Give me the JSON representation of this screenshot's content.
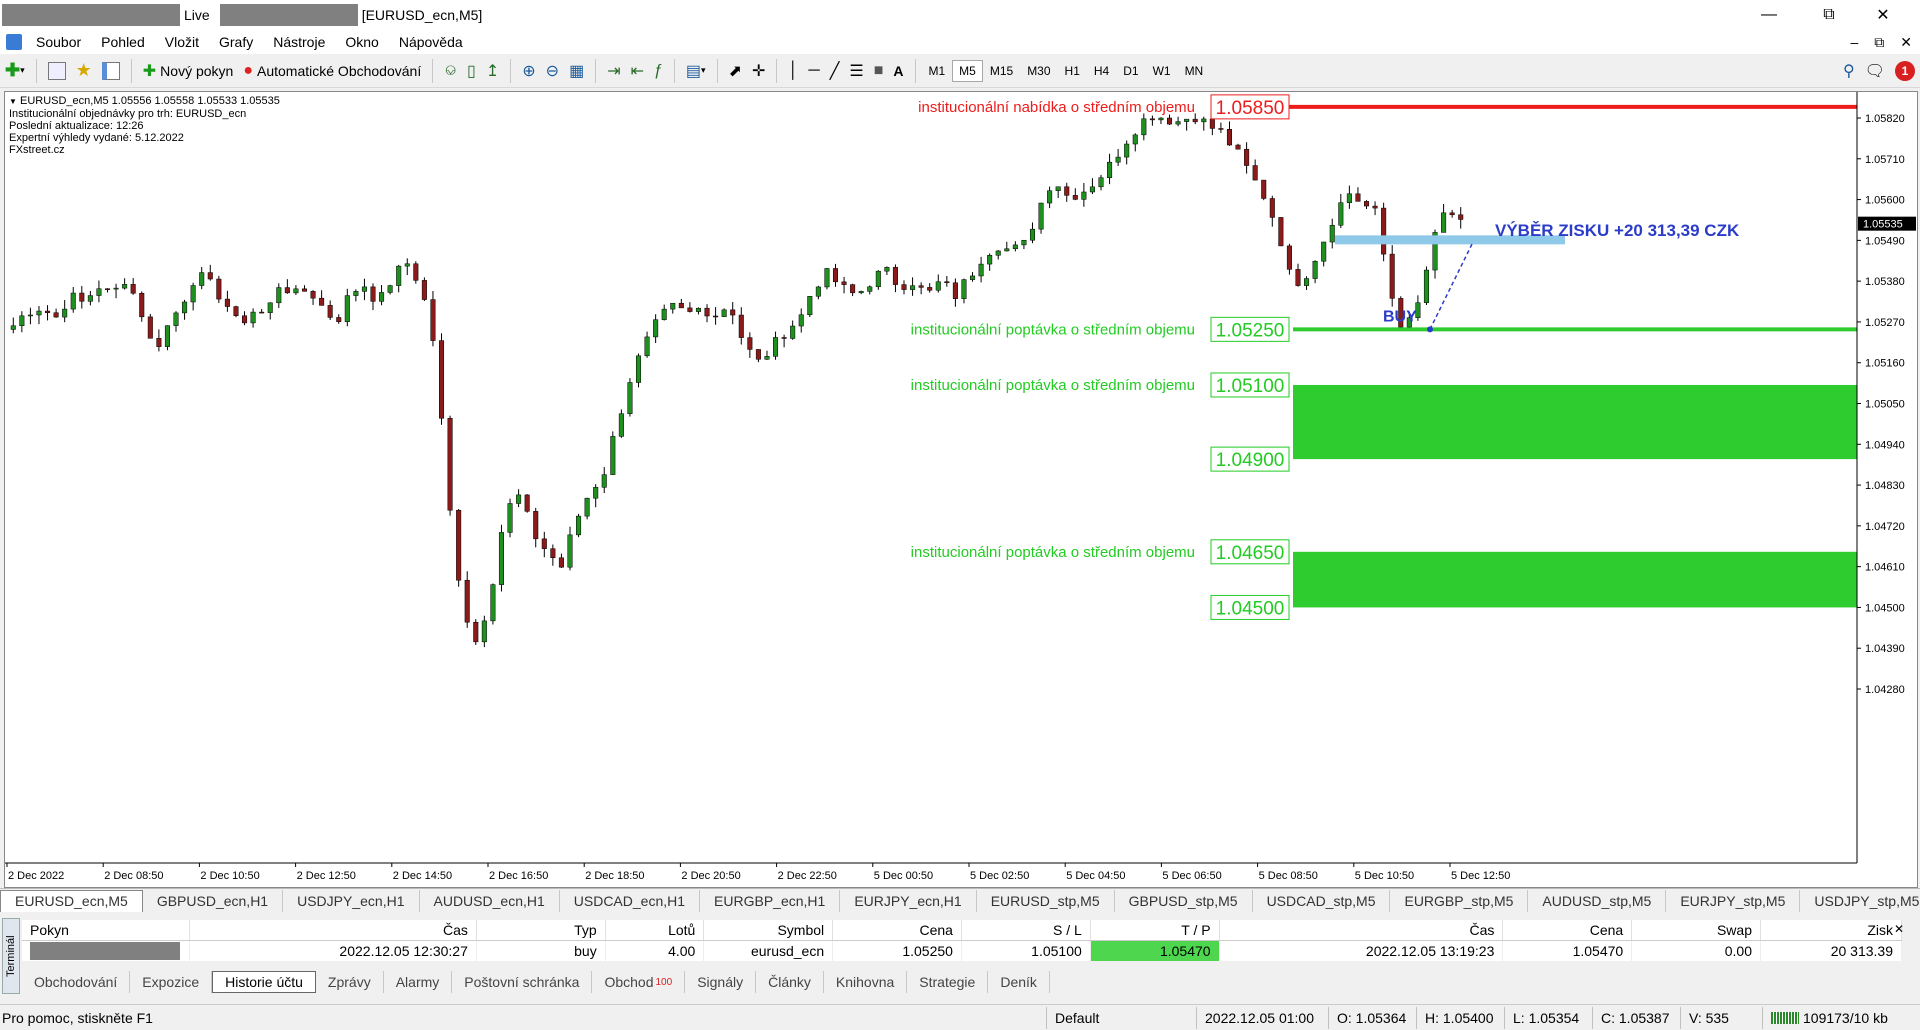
{
  "window": {
    "live_label": "Live",
    "title": "[EURUSD_ecn,M5]"
  },
  "menu": [
    "Soubor",
    "Pohled",
    "Vložit",
    "Grafy",
    "Nástroje",
    "Okno",
    "Nápověda"
  ],
  "toolbar": {
    "new_order": "Nový pokyn",
    "auto_trading": "Automatické Obchodování",
    "timeframes": [
      "M1",
      "M5",
      "M15",
      "M30",
      "H1",
      "H4",
      "D1",
      "W1",
      "MN"
    ],
    "active_timeframe": "M5",
    "text_tool": "A",
    "notification_count": "1"
  },
  "chart_info": {
    "line1": "EURUSD_ecn,M5  1.05556 1.05558 1.05533 1.05535",
    "line2": "Institucionální objednávky pro trh: EURUSD_ecn",
    "line3": "Poslední aktualizace: 12:26",
    "line4": "Expertní výhledy vydané: 5.12.2022",
    "line5": "FXstreet.cz"
  },
  "chart_data": {
    "type": "candlestick",
    "symbol": "EURUSD_ecn",
    "timeframe": "M5",
    "y_ticks": [
      "1.05820",
      "1.05710",
      "1.05600",
      "1.05490",
      "1.05380",
      "1.05270",
      "1.05160",
      "1.05050",
      "1.04940",
      "1.04830",
      "1.04720",
      "1.04610",
      "1.04500",
      "1.04390",
      "1.04280"
    ],
    "x_ticks": [
      "2 Dec 2022",
      "2 Dec 08:50",
      "2 Dec 10:50",
      "2 Dec 12:50",
      "2 Dec 14:50",
      "2 Dec 16:50",
      "2 Dec 18:50",
      "2 Dec 20:50",
      "2 Dec 22:50",
      "5 Dec 00:50",
      "5 Dec 02:50",
      "5 Dec 04:50",
      "5 Dec 06:50",
      "5 Dec 08:50",
      "5 Dec 10:50",
      "5 Dec 12:50"
    ],
    "ylim": [
      1.0424,
      1.0589
    ],
    "current_price": "1.05535",
    "path": [
      1.0526,
      1.053,
      1.0531,
      1.0528,
      1.0534,
      1.0532,
      1.0537,
      1.0534,
      1.0539,
      1.0531,
      1.0519,
      1.0526,
      1.0532,
      1.054,
      1.0537,
      1.0533,
      1.0526,
      1.053,
      1.0529,
      1.0538,
      1.0534,
      1.0536,
      1.0531,
      1.0527,
      1.0535,
      1.0537,
      1.0532,
      1.0539,
      1.0543,
      1.0537,
      1.052,
      1.0478,
      1.045,
      1.044,
      1.0455,
      1.0476,
      1.048,
      1.047,
      1.0465,
      1.0461,
      1.0473,
      1.0481,
      1.0486,
      1.05,
      1.0513,
      1.0521,
      1.0528,
      1.0531,
      1.0529,
      1.0531,
      1.0529,
      1.0532,
      1.0521,
      1.0516,
      1.052,
      1.0525,
      1.0528,
      1.0537,
      1.054,
      1.0536,
      1.0534,
      1.0538,
      1.0541,
      1.0537,
      1.0538,
      1.0534,
      1.0538,
      1.0534,
      1.0539,
      1.0545,
      1.0548,
      1.0546,
      1.0548,
      1.0558,
      1.0566,
      1.0561,
      1.0562,
      1.0565,
      1.0569,
      1.0575,
      1.058,
      1.0583,
      1.0582,
      1.0581,
      1.0583,
      1.058,
      1.0578,
      1.0573,
      1.0567,
      1.0561,
      1.0552,
      1.0537,
      1.054,
      1.0547,
      1.0556,
      1.0562,
      1.0559,
      1.0556,
      1.0535,
      1.0524,
      1.0532,
      1.0548,
      1.0558,
      1.0553
    ],
    "levels": [
      {
        "label": "institucionální nabídka o středním objemu",
        "price": "1.05850",
        "color": "#ee1c1c"
      },
      {
        "label": "institucionální poptávka o středním objemu",
        "price": "1.05250",
        "color": "#22cc22"
      },
      {
        "label": "institucionální poptávka o středním objemu",
        "price": "1.05100",
        "price2": "1.04900",
        "color": "#22cc22"
      },
      {
        "label": "institucionální poptávka o středním objemu",
        "price": "1.04650",
        "price2": "1.04500",
        "color": "#22cc22"
      }
    ],
    "annotations": {
      "buy": "BUY",
      "profit": "VÝBĚR ZISKU +20 313,39 CZK"
    }
  },
  "chart_tabs": [
    "EURUSD_ecn,M5",
    "GBPUSD_ecn,H1",
    "USDJPY_ecn,H1",
    "AUDUSD_ecn,H1",
    "USDCAD_ecn,H1",
    "EURGBP_ecn,H1",
    "EURJPY_ecn,H1",
    "EURUSD_stp,M5",
    "GBPUSD_stp,M5",
    "USDCAD_stp,M5",
    "EURGBP_stp,M5",
    "AUDUSD_stp,M5",
    "EURJPY_stp,M5",
    "USDJPY_stp,M5"
  ],
  "terminal": {
    "side_label": "Terminál",
    "headers": [
      "Pokyn",
      "Čas",
      "Typ",
      "Lotů",
      "Symbol",
      "Cena",
      "S / L",
      "T / P",
      "Čas",
      "Cena",
      "Swap",
      "Zisk"
    ],
    "row": [
      "",
      "2022.12.05 12:30:27",
      "buy",
      "4.00",
      "eurusd_ecn",
      "1.05250",
      "1.05100",
      "1.05470",
      "2022.12.05 13:19:23",
      "1.05470",
      "0.00",
      "20 313.39"
    ],
    "tabs": [
      "Obchodování",
      "Expozice",
      "Historie účtu",
      "Zprávy",
      "Alarmy",
      "Poštovní schránka",
      "Obchod",
      "Signály",
      "Články",
      "Knihovna",
      "Strategie",
      "Deník"
    ],
    "obchod_badge": "100",
    "active_tab": "Historie účtu"
  },
  "status": {
    "help": "Pro pomoc, stiskněte F1",
    "profile": "Default",
    "time": "2022.12.05 01:00",
    "open": "O: 1.05364",
    "high": "H: 1.05400",
    "low": "L: 1.05354",
    "close": "C: 1.05387",
    "volume": "V: 535",
    "traffic": "109173/10 kb"
  }
}
